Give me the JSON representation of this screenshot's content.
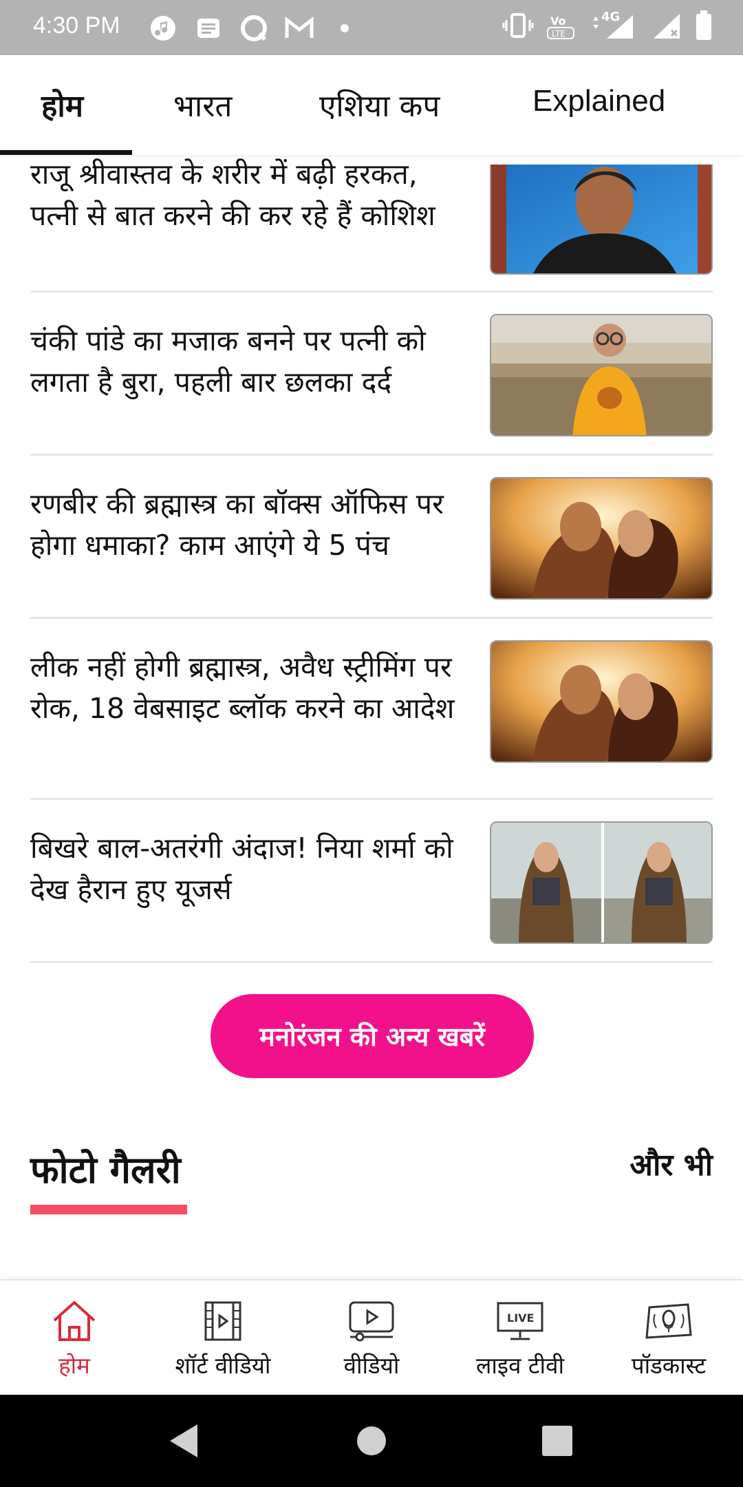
{
  "status_bar": {
    "time": "4:30 PM",
    "network_label": "4G"
  },
  "tabs": [
    {
      "label": "होम",
      "active": true
    },
    {
      "label": "भारत",
      "active": false
    },
    {
      "label": "एशिया कप",
      "active": false
    },
    {
      "label": "Explained",
      "active": false
    }
  ],
  "news": [
    {
      "title": "राजू श्रीवास्तव के शरीर में बढ़ी हरकत, पत्नी से बात करने की कर रहे हैं कोशिश",
      "thumb": "raju-photo"
    },
    {
      "title": "चंकी पांडे का मजाक बनने पर पत्नी को लगता है बुरा, पहली बार छलका दर्द",
      "thumb": "chunky-photo"
    },
    {
      "title": "रणबीर की ब्रह्मास्त्र का बॉक्स ऑफिस पर होगा धमाका? काम आएंगे ये 5 पंच",
      "thumb": "brahmastra-poster"
    },
    {
      "title": "लीक नहीं होगी ब्रह्मास्त्र, अवैध स्ट्रीमिंग पर रोक, 18 वेबसाइट ब्लॉक करने का आदेश",
      "thumb": "brahmastra-poster"
    },
    {
      "title": "बिखरे बाल-अतरंगी अंदाज! निया शर्मा को देख हैरान हुए यूजर्स",
      "thumb": "nia-photo"
    }
  ],
  "more_button": "मनोरंजन की अन्य खबरें",
  "gallery": {
    "title": "फोटो गैलरी",
    "more": "और भी"
  },
  "bottom_nav": [
    {
      "label": "होम",
      "icon": "home-icon",
      "active": true
    },
    {
      "label": "शॉर्ट वीडियो",
      "icon": "film-icon",
      "active": false
    },
    {
      "label": "वीडियो",
      "icon": "video-play-icon",
      "active": false
    },
    {
      "label": "लाइव टीवी",
      "icon": "live-tv-icon",
      "active": false
    },
    {
      "label": "पॉडकास्ट",
      "icon": "podcast-icon",
      "active": false
    }
  ],
  "colors": {
    "accent_pink": "#f2118a",
    "active_red": "#d92a3a",
    "underline_red": "#f05060"
  }
}
